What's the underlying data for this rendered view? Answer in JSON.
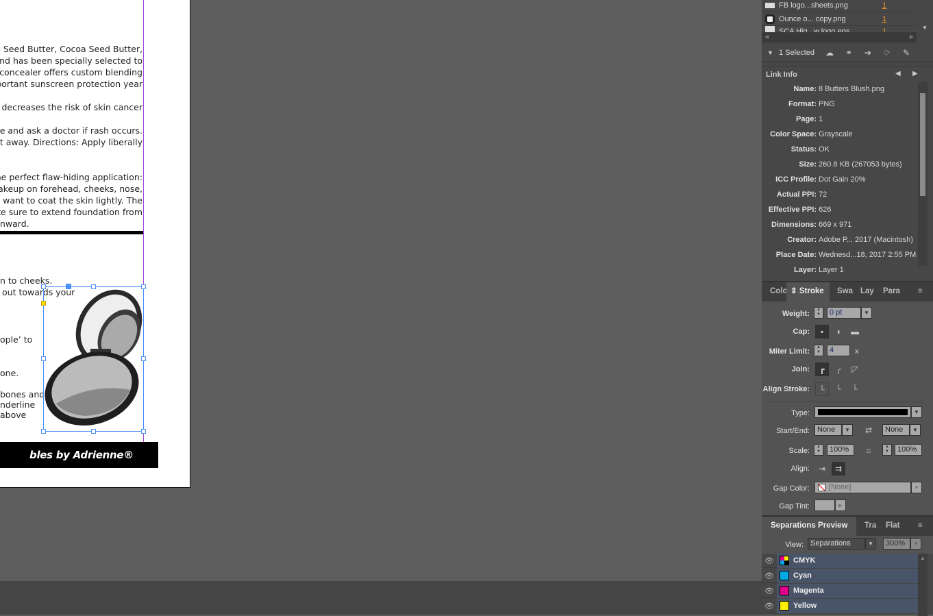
{
  "document": {
    "body_lines": [
      "go Seed Butter, Cocoa Seed Butter,",
      "lend has been specially selected to",
      "concealer offers custom blending",
      "portant sunscreen protection year",
      "l), decreases the risk of skin cancer",
      "use and ask a doctor if rash occurs.",
      "ht away. Directions: Apply liberally",
      "he perfect flaw-hiding application:",
      "Makeup on forehead, cheeks, nose,",
      "u want to coat the skin lightly. The",
      "ke sure to extend foundation from",
      "nward."
    ],
    "lower_lines": [
      "n to cheeks.",
      "out towards your",
      "ople’ to",
      "one.",
      "bones and",
      "nderline",
      "above"
    ],
    "banner": "bles by Adrienne® jewelry."
  },
  "links_panel": {
    "items": [
      {
        "name": "FB logo...sheets.png",
        "page": "1"
      },
      {
        "name": "Ounce o... copy.png",
        "page": "1"
      },
      {
        "name": "SCA Hig...w logo.eps",
        "page": "1"
      }
    ],
    "selected": "1 Selected",
    "link_info_title": "Link Info",
    "info": [
      {
        "label": "Name:",
        "value": "8 Butters Blush.png"
      },
      {
        "label": "Format:",
        "value": "PNG"
      },
      {
        "label": "Page:",
        "value": "1"
      },
      {
        "label": "Color Space:",
        "value": "Grayscale"
      },
      {
        "label": "Status:",
        "value": "OK"
      },
      {
        "label": "Size:",
        "value": "260.8 KB (267053 bytes)"
      },
      {
        "label": "ICC Profile:",
        "value": "Dot Gain 20%"
      },
      {
        "label": "Actual PPI:",
        "value": "72"
      },
      {
        "label": "Effective PPI:",
        "value": "626"
      },
      {
        "label": "Dimensions:",
        "value": "669 x 971"
      },
      {
        "label": "Creator:",
        "value": "Adobe P... 2017 (Macintosh)"
      },
      {
        "label": "Place Date:",
        "value": "Wednesd...18, 2017 2:55 PM"
      },
      {
        "label": "Layer:",
        "value": "Layer 1"
      }
    ]
  },
  "stroke_panel": {
    "tabs": [
      "Colo",
      "Stroke",
      "Swa",
      "Laye",
      "Para"
    ],
    "weight_label": "Weight:",
    "weight": "0 pt",
    "cap_label": "Cap:",
    "miter_label": "Miter Limit:",
    "miter": "4",
    "miter_unit": "x",
    "join_label": "Join:",
    "align_stroke_label": "Align Stroke:",
    "type_label": "Type:",
    "start_end_label": "Start/End:",
    "start": "None",
    "end": "None",
    "scale_label": "Scale:",
    "scale_start": "100%",
    "scale_end": "100%",
    "align_label": "Align:",
    "gap_color_label": "Gap Color:",
    "gap_color": "[None]",
    "gap_tint_label": "Gap Tint:"
  },
  "separations_panel": {
    "tabs": [
      "Separations Preview",
      "Tra",
      "Flat"
    ],
    "view_label": "View:",
    "view": "Separations",
    "zoom": "300%",
    "rows": [
      {
        "name": "CMYK",
        "color": "#000000"
      },
      {
        "name": "Cyan",
        "color": "#00a8e8"
      },
      {
        "name": "Magenta",
        "color": "#e0008a"
      },
      {
        "name": "Yellow",
        "color": "#ffee00"
      }
    ]
  }
}
